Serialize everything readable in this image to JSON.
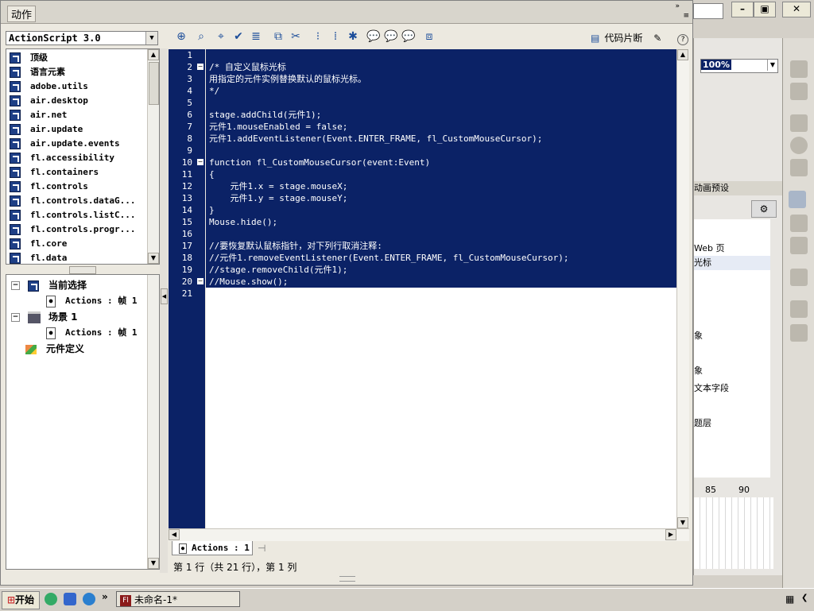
{
  "panel": {
    "title": "动作"
  },
  "language_select": {
    "value": "ActionScript 3.0"
  },
  "toolbox": {
    "items": [
      "顶级",
      "语言元素",
      "adobe.utils",
      "air.desktop",
      "air.net",
      "air.update",
      "air.update.events",
      "fl.accessibility",
      "fl.containers",
      "fl.controls",
      "fl.controls.dataG...",
      "fl.controls.listC...",
      "fl.controls.progr...",
      "fl.core",
      "fl.data"
    ]
  },
  "tree": {
    "current_selection": "当前选择",
    "current_actions": "Actions : 帧 1",
    "scene": "场景 1",
    "scene_actions": "Actions : 帧 1",
    "symbol_defs": "元件定义"
  },
  "toolbar": {
    "snippets_label": "代码片断"
  },
  "code": {
    "lines": [
      "",
      "/* 自定义鼠标光标",
      "用指定的元件实例替换默认的鼠标光标。",
      "*/",
      "",
      "stage.addChild(元件1);",
      "元件1.mouseEnabled = false;",
      "元件1.addEventListener(Event.ENTER_FRAME, fl_CustomMouseCursor);",
      "",
      "function fl_CustomMouseCursor(event:Event)",
      "{",
      "    元件1.x = stage.mouseX;",
      "    元件1.y = stage.mouseY;",
      "}",
      "Mouse.hide();",
      "",
      "//要恢复默认鼠标指针，对下列行取消注释:",
      "//元件1.removeEventListener(Event.ENTER_FRAME, fl_CustomMouseCursor);",
      "//stage.removeChild(元件1);",
      "//Mouse.show();",
      ""
    ],
    "line_numbers": [
      "1",
      "2",
      "3",
      "4",
      "5",
      "6",
      "7",
      "8",
      "9",
      "10",
      "11",
      "12",
      "13",
      "14",
      "15",
      "16",
      "17",
      "18",
      "19",
      "20",
      "21"
    ]
  },
  "script_tab": {
    "label": "Actions : 1"
  },
  "status": {
    "text": "第 1 行（共 21 行），第 1 列"
  },
  "background_app": {
    "zoom": "100%",
    "panel_tab": "动画预设",
    "list_items": [
      "Web 页",
      "光标",
      "象",
      "象",
      "文本字段",
      "题层"
    ],
    "timeline_ticks": [
      "85",
      "90"
    ]
  },
  "taskbar": {
    "start": "开始",
    "task": "未命名-1*"
  },
  "colors": {
    "selection": "#0b2266",
    "panel": "#ece9e0"
  }
}
